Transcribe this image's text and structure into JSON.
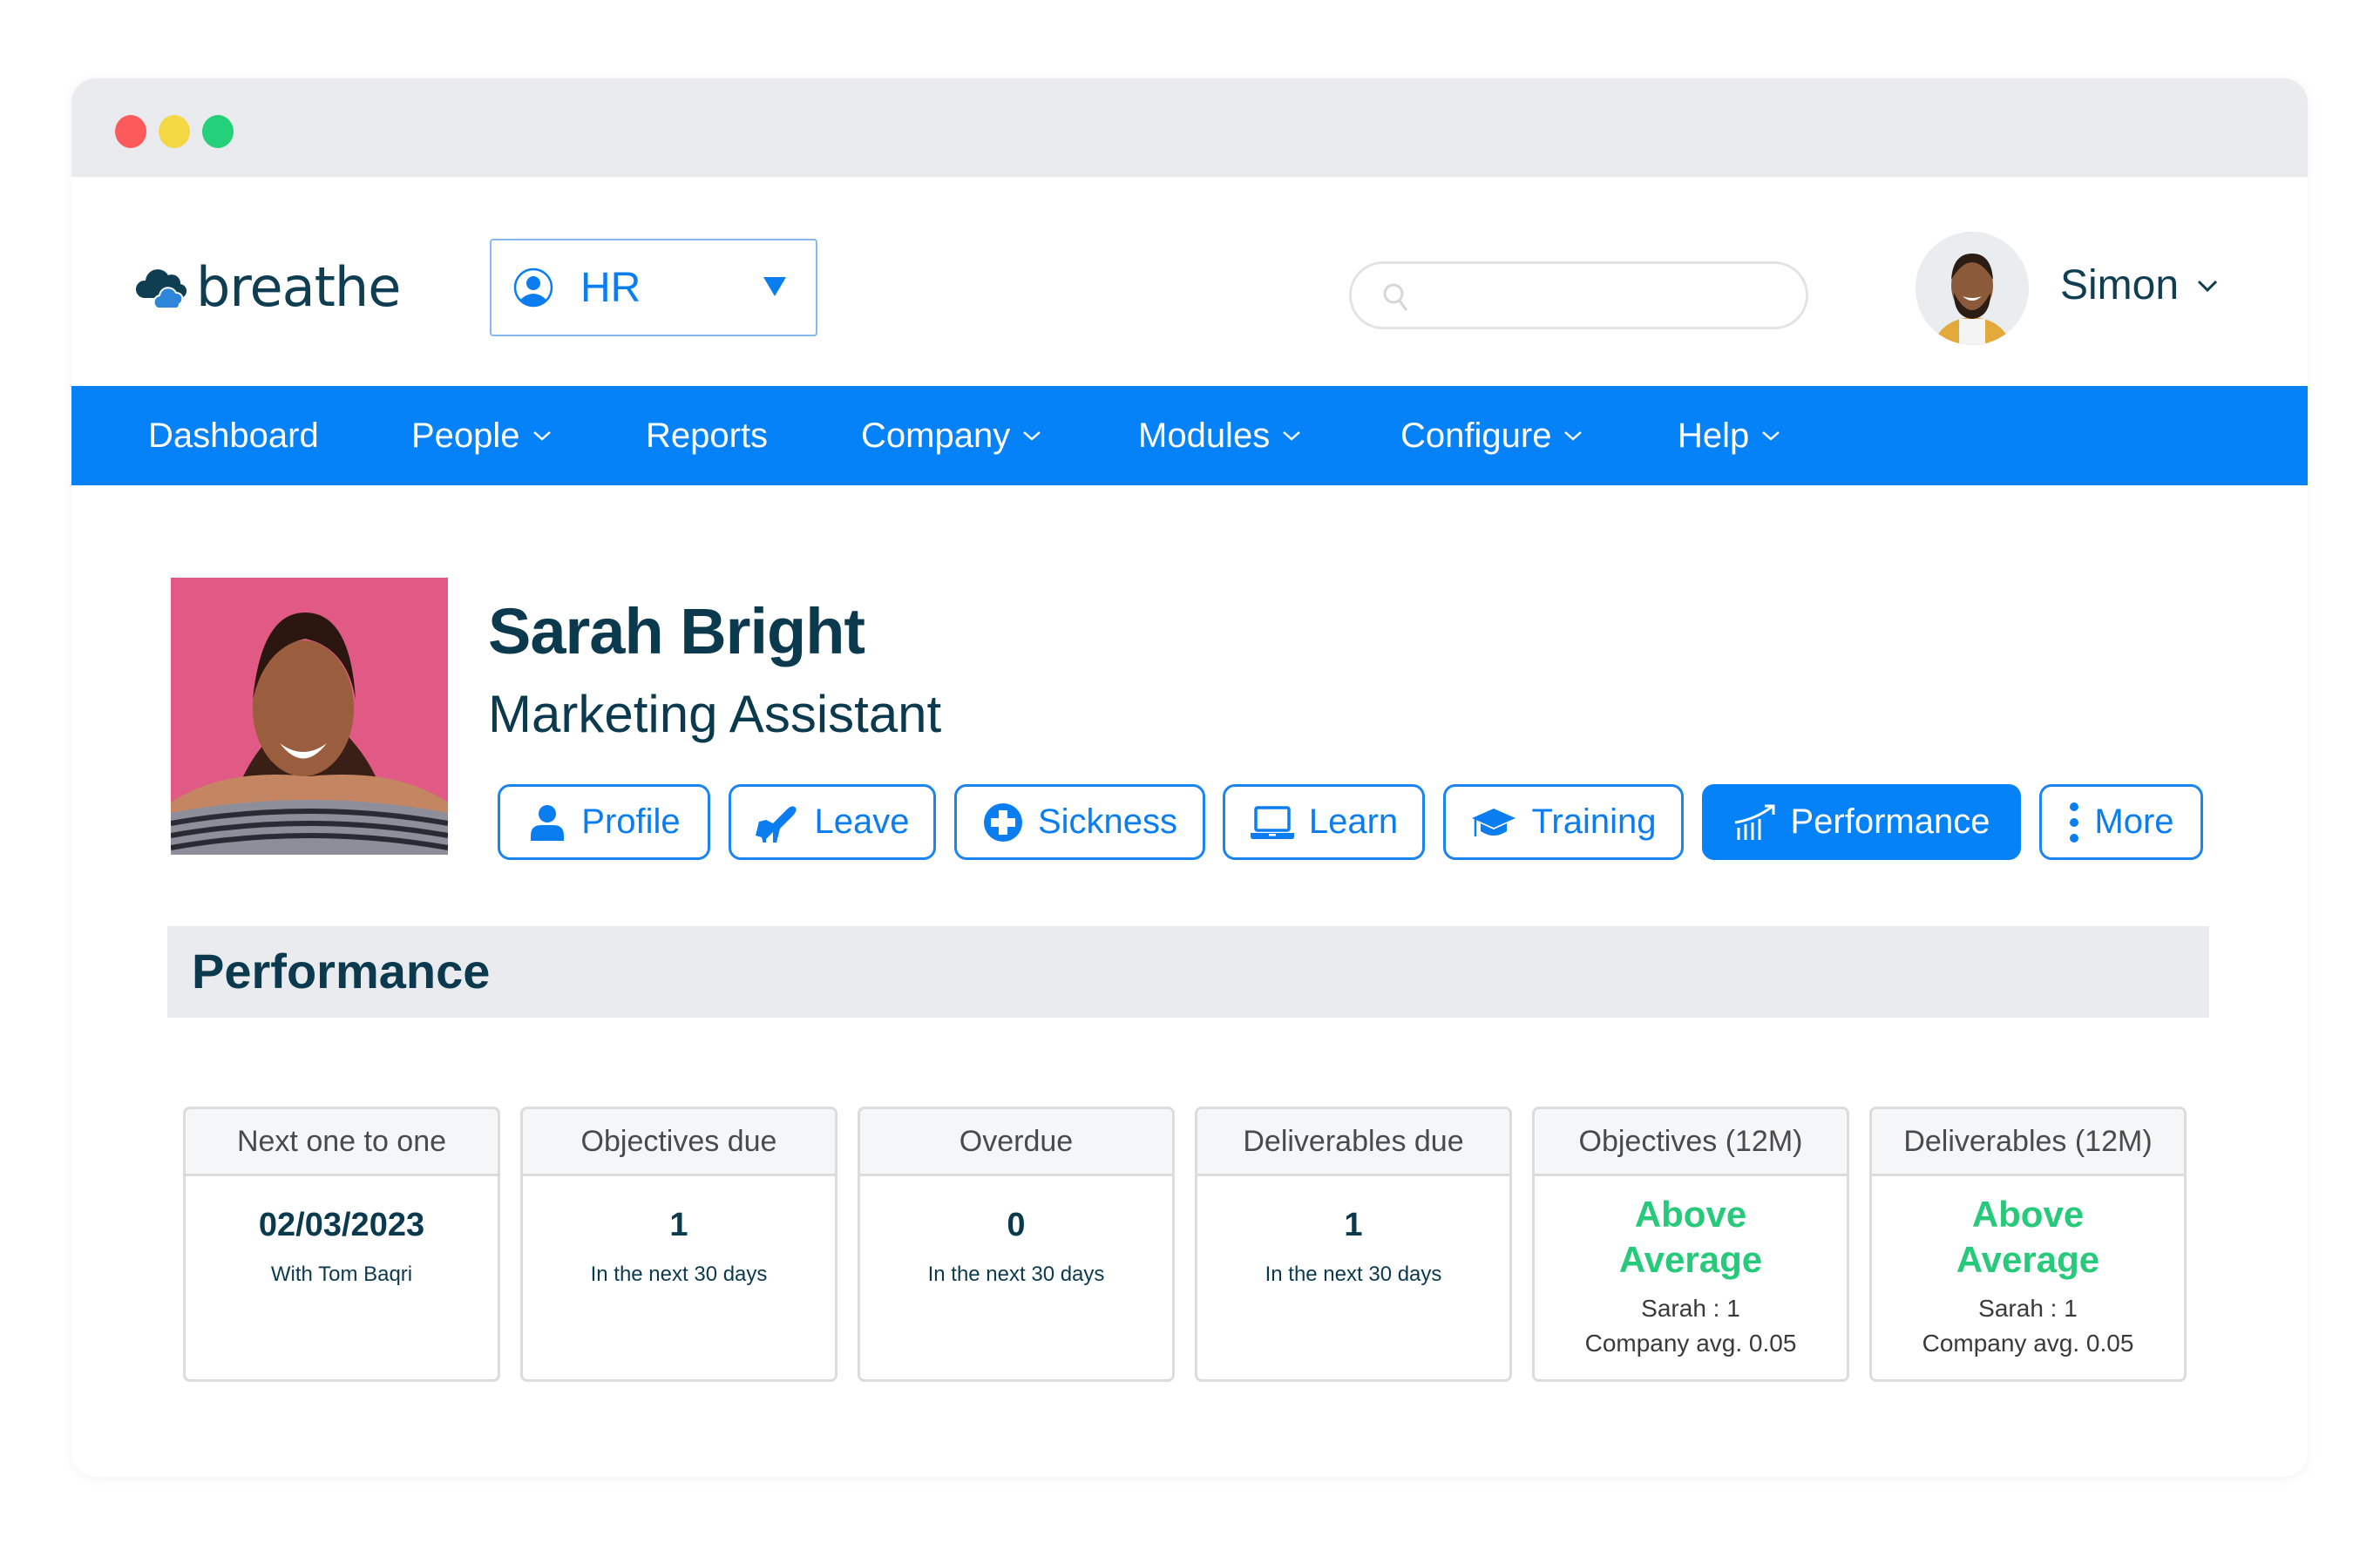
{
  "window": {
    "controls": [
      "close",
      "minimize",
      "maximize"
    ],
    "colors": {
      "close": "#fc5a5b",
      "minimize": "#f4d843",
      "maximize": "#25d07a"
    }
  },
  "header": {
    "logo_text": "breathe",
    "module_select": {
      "icon": "user-circle-icon",
      "value": "HR"
    },
    "search": {
      "placeholder": "",
      "value": ""
    },
    "user": {
      "name": "Simon"
    }
  },
  "nav": {
    "items": [
      {
        "label": "Dashboard",
        "has_dropdown": false
      },
      {
        "label": "People",
        "has_dropdown": true
      },
      {
        "label": "Reports",
        "has_dropdown": false
      },
      {
        "label": "Company",
        "has_dropdown": true
      },
      {
        "label": "Modules",
        "has_dropdown": true
      },
      {
        "label": "Configure",
        "has_dropdown": true
      },
      {
        "label": "Help",
        "has_dropdown": true
      }
    ],
    "color": "#0682f9"
  },
  "employee": {
    "name": "Sarah Bright",
    "job_title": "Marketing Assistant"
  },
  "tabs": [
    {
      "label": "Profile",
      "icon": "user-icon",
      "active": false
    },
    {
      "label": "Leave",
      "icon": "plane-icon",
      "active": false
    },
    {
      "label": "Sickness",
      "icon": "medical-cross-icon",
      "active": false
    },
    {
      "label": "Learn",
      "icon": "laptop-icon",
      "active": false
    },
    {
      "label": "Training",
      "icon": "graduation-cap-icon",
      "active": false
    },
    {
      "label": "Performance",
      "icon": "growth-chart-icon",
      "active": true
    },
    {
      "label": "More",
      "icon": "vertical-dots-icon",
      "active": false
    }
  ],
  "section": {
    "title": "Performance"
  },
  "cards": [
    {
      "title": "Next one to one",
      "value": "02/03/2023",
      "sub": "With Tom Baqri"
    },
    {
      "title": "Objectives due",
      "value": "1",
      "sub": "In the next 30 days"
    },
    {
      "title": "Overdue",
      "value": "0",
      "sub": "In the next 30 days"
    },
    {
      "title": "Deliverables due",
      "value": "1",
      "sub": "In the next 30 days"
    },
    {
      "title": "Objectives (12M)",
      "rating_line1": "Above",
      "rating_line2": "Average",
      "person_stat": "Sarah : 1",
      "company_stat": "Company avg. 0.05"
    },
    {
      "title": "Deliverables (12M)",
      "rating_line1": "Above",
      "rating_line2": "Average",
      "person_stat": "Sarah : 1",
      "company_stat": "Company avg. 0.05"
    }
  ],
  "colors": {
    "accent": "#0682f9",
    "text_dark": "#0b3a4f",
    "positive": "#27c97a"
  }
}
